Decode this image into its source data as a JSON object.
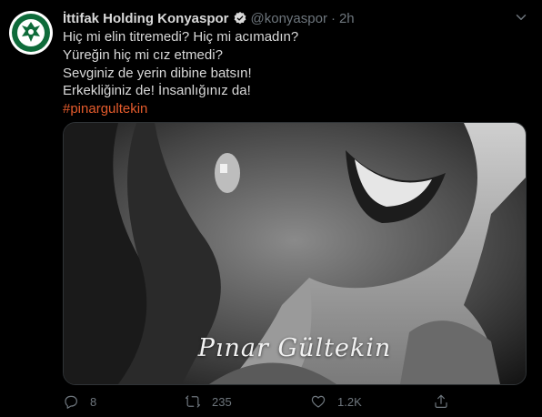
{
  "tweet": {
    "display_name": "İttifak Holding Konyaspor",
    "handle": "@konyaspor",
    "separator": "·",
    "time": "2h",
    "lines": [
      "Hiç mi elin titremedi? Hiç mi acımadın?",
      "Yüreğin hiç mi cız etmedi?",
      "Sevginiz de yerin dibine batsın!",
      "Erkekliğiniz de! İnsanlığınız da!"
    ],
    "hashtag": "#pinargultekin",
    "media_caption": "Pınar Gültekin"
  },
  "actions": {
    "reply_count": "8",
    "retweet_count": "235",
    "like_count": "1.2K"
  },
  "colors": {
    "background": "#000000",
    "text": "#d9d9d9",
    "secondary": "#6e767d",
    "hashtag": "#e45b2c",
    "logo_green": "#0e6b3a"
  },
  "icons": [
    "verified-badge-icon",
    "caret-down-icon",
    "reply-icon",
    "retweet-icon",
    "like-icon",
    "share-icon"
  ]
}
